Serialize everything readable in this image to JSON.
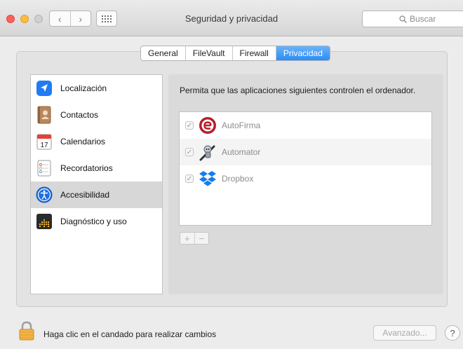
{
  "window": {
    "title": "Seguridad y privacidad",
    "search_placeholder": "Buscar",
    "nav_back": "‹",
    "nav_forward": "›"
  },
  "tabs": [
    {
      "label": "General",
      "active": false
    },
    {
      "label": "FileVault",
      "active": false
    },
    {
      "label": "Firewall",
      "active": false
    },
    {
      "label": "Privacidad",
      "active": true
    }
  ],
  "sidebar": {
    "items": [
      {
        "label": "Localización",
        "icon": "location-arrow-icon",
        "selected": false
      },
      {
        "label": "Contactos",
        "icon": "contacts-book-icon",
        "selected": false
      },
      {
        "label": "Calendarios",
        "icon": "calendar-icon",
        "selected": false
      },
      {
        "label": "Recordatorios",
        "icon": "reminders-icon",
        "selected": false
      },
      {
        "label": "Accesibilidad",
        "icon": "accessibility-icon",
        "selected": true
      },
      {
        "label": "Diagnóstico y uso",
        "icon": "diagnostics-icon",
        "selected": false
      }
    ]
  },
  "content": {
    "prompt": "Permita que las aplicaciones siguientes controlen el ordenador.",
    "apps": [
      {
        "name": "AutoFirma",
        "checked": true,
        "icon": "autofirma-icon"
      },
      {
        "name": "Automator",
        "checked": true,
        "icon": "automator-robot-icon"
      },
      {
        "name": "Dropbox",
        "checked": true,
        "icon": "dropbox-icon"
      }
    ],
    "add_label": "+",
    "remove_label": "−"
  },
  "footer": {
    "lock_message": "Haga clic en el candado para realizar cambios",
    "advanced_label": "Avanzado...",
    "help_label": "?"
  },
  "colors": {
    "accent": "#2a8df6",
    "close": "#fc605c",
    "minimize": "#fdbc40"
  }
}
